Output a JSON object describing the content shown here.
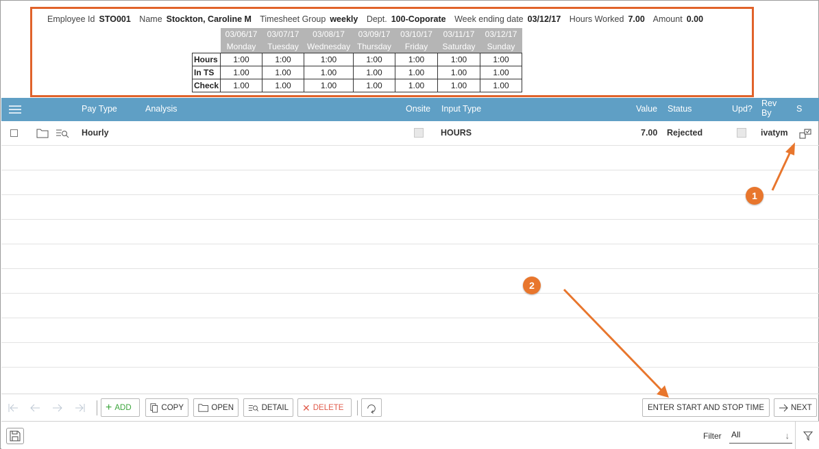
{
  "summary": {
    "employee_id_label": "Employee Id",
    "employee_id": "STO001",
    "name_label": "Name",
    "name": "Stockton, Caroline M",
    "group_label": "Timesheet Group",
    "group": "weekly",
    "dept_label": "Dept.",
    "dept": "100-Coporate",
    "week_label": "Week ending date",
    "week": "03/12/17",
    "hours_label": "Hours Worked",
    "hours": "7.00",
    "amount_label": "Amount",
    "amount": "0.00"
  },
  "week_table": {
    "dates": [
      "03/06/17",
      "03/07/17",
      "03/08/17",
      "03/09/17",
      "03/10/17",
      "03/11/17",
      "03/12/17"
    ],
    "days": [
      "Monday",
      "Tuesday",
      "Wednesday",
      "Thursday",
      "Friday",
      "Saturday",
      "Sunday"
    ],
    "rows": [
      {
        "label": "Hours",
        "values": [
          "1:00",
          "1:00",
          "1:00",
          "1:00",
          "1:00",
          "1:00",
          "1:00"
        ]
      },
      {
        "label": "In TS",
        "values": [
          "1.00",
          "1.00",
          "1.00",
          "1.00",
          "1.00",
          "1.00",
          "1.00"
        ]
      },
      {
        "label": "Check",
        "values": [
          "1.00",
          "1.00",
          "1.00",
          "1.00",
          "1.00",
          "1.00",
          "1.00"
        ]
      }
    ]
  },
  "grid": {
    "columns": {
      "pay_type": "Pay Type",
      "analysis": "Analysis",
      "onsite": "Onsite",
      "input_type": "Input Type",
      "value": "Value",
      "status": "Status",
      "upd": "Upd?",
      "rev_by_1": "Rev",
      "rev_by_2": "By",
      "s": "S"
    },
    "row": {
      "pay_type": "Hourly",
      "input_type": "HOURS",
      "value": "7.00",
      "status": "Rejected",
      "rev_by": "ivatym"
    }
  },
  "toolbar": {
    "add": "ADD",
    "copy": "COPY",
    "open": "OPEN",
    "detail": "DETAIL",
    "delete": "DELETE",
    "enter_time": "ENTER START AND STOP TIME",
    "next": "NEXT"
  },
  "footer": {
    "filter_label": "Filter",
    "filter_value": "All"
  },
  "callouts": {
    "one": "1",
    "two": "2"
  },
  "colors": {
    "highlight_border": "#e0622a",
    "grid_header": "#5f9fc5",
    "callout": "#e8762d"
  }
}
